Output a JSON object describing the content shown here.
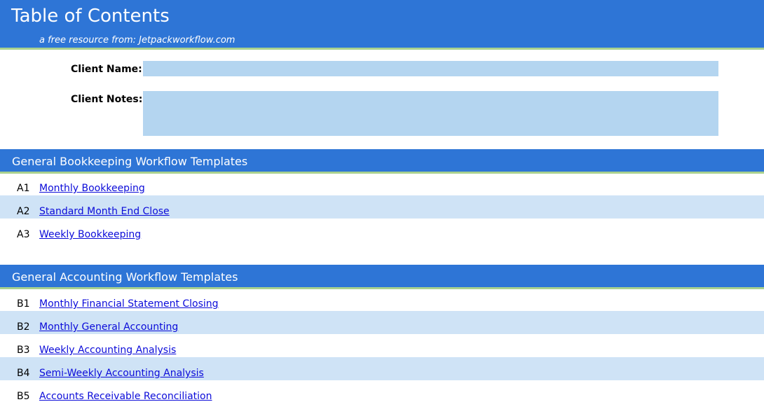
{
  "header": {
    "title": "Table of Contents",
    "subtitle": "a free resource from: Jetpackworkflow.com"
  },
  "client": {
    "name_label": "Client Name:",
    "name_value": "",
    "notes_label": "Client Notes:",
    "notes_value": ""
  },
  "sections": [
    {
      "title": "General Bookkeeping Workflow Templates",
      "items": [
        {
          "code": "A1",
          "label": "Monthly Bookkeeping"
        },
        {
          "code": "A2",
          "label": "Standard Month End Close"
        },
        {
          "code": "A3",
          "label": "Weekly Bookkeeping"
        }
      ]
    },
    {
      "title": "General Accounting Workflow Templates",
      "items": [
        {
          "code": "B1",
          "label": "Monthly Financial Statement Closing"
        },
        {
          "code": "B2",
          "label": "Monthly General Accounting"
        },
        {
          "code": "B3",
          "label": "Weekly Accounting Analysis"
        },
        {
          "code": "B4",
          "label": "Semi-Weekly Accounting Analysis"
        },
        {
          "code": "B5",
          "label": "Accounts Receivable Reconciliation"
        }
      ]
    }
  ],
  "colors": {
    "header_blue": "#2e75d6",
    "accent_green": "#a9d18e",
    "field_blue": "#b4d5f0",
    "row_shade": "#cfe3f6",
    "link_blue": "#0b0bd9"
  }
}
